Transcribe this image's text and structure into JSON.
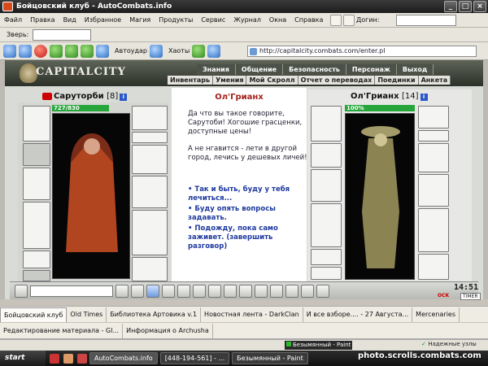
{
  "window": {
    "title": "Бойцовский клуб - AutoCombats.info"
  },
  "menu": [
    "Файл",
    "Правка",
    "Вид",
    "Избранное",
    "Магия",
    "Продукты",
    "Сервис",
    "Журнал",
    "Окна",
    "Справка"
  ],
  "toolbar": {
    "login_label": "Догин:",
    "beast_label": "Зверь:",
    "autoudar": "Автоудар",
    "haoty": "Хаоты"
  },
  "address": {
    "url": "http://capitalcity.combats.com/enter.pl"
  },
  "game": {
    "logo": "CAPITALCITY",
    "nav_top": [
      "Знания",
      "Общение",
      "Безопасность",
      "Персонаж",
      "Выход"
    ],
    "nav_bottom": [
      "Инвентарь",
      "Умения",
      "Мой Скролл",
      "Отчет о переводах",
      "Поединки",
      "Анкета"
    ],
    "player": {
      "name": "Саруторби",
      "level": "[8]",
      "hp": "727/830",
      "hp_ratio": 0.876
    },
    "npc": {
      "name": "Ол'Грианх",
      "level": "[14]",
      "hp": "100%",
      "hp_ratio": 1.0
    },
    "dialog": {
      "title": "Ол'Грианх",
      "paragraphs": [
        "Да что вы такое говорите, Сарутоби! Хогошие грасценки, доступные цены!",
        "А не нгавится - лети в другой город, лечись у дешевых личей!"
      ],
      "choices": [
        "• Так и быть, буду у тебя лечиться...",
        "• Буду опять вопросы задавать.",
        "• Подожду, пока само заживет. (завершить разговор)"
      ]
    },
    "clock": "14:51",
    "timer": "TIMER",
    "nxt": "OCK"
  },
  "tabs_row1": [
    "Бойцовский клуб",
    "Old Times",
    "Библиотека Артовика v.1",
    "Новостная лента - DarkClan",
    "И все взборе.... - 27 Августа...",
    "Mercenaries"
  ],
  "tabs_row2": [
    "Редактирование материала - Gl...",
    "Информация о Archusha"
  ],
  "status": {
    "paint": "Безымянный - Paint",
    "reliable": "Надежные узлы"
  },
  "taskbar": {
    "start": "start",
    "tasks": [
      "AutoCombats.info",
      "[448-194-561] - ...",
      "Безымянный - Paint"
    ]
  },
  "watermark": "photo.scrolls.combats.com"
}
